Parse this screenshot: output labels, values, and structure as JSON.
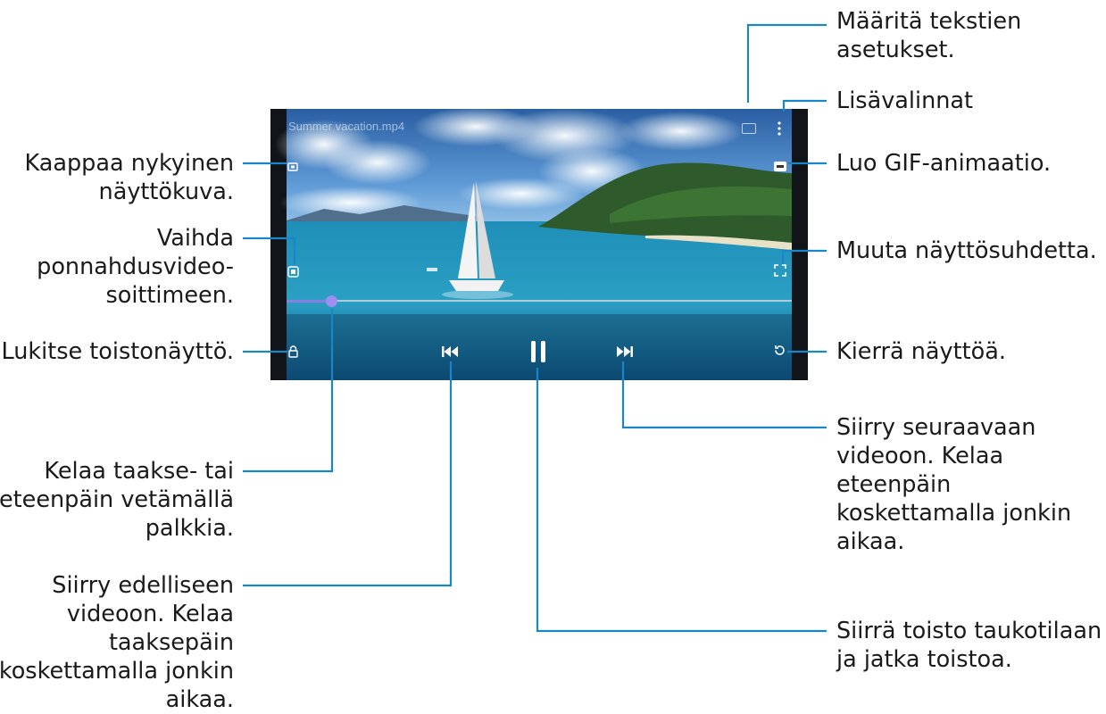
{
  "player": {
    "video_title": "Summer vacation.mp4",
    "progress_fraction": 0.09
  },
  "callouts": {
    "subtitles": "Määritä tekstien\nasetukset.",
    "more_options": "Lisävalinnat",
    "gif": "Luo GIF-animaatio.",
    "screen_ratio": "Muuta näyttösuhdetta.",
    "rotate": "Kierrä näyttöä.",
    "next": "Siirry seuraavaan\nvideoon. Kelaa\neteenpäin\nkoskettamalla jonkin\naikaa.",
    "pause": "Siirrä toisto taukotilaan\nja jatka toistoa.",
    "capture": "Kaappaa nykyinen\nnäyttökuva.",
    "popup": "Vaihda\nponnahdusvideo-\nsoittimeen.",
    "lock": "Lukitse toistonäyttö.",
    "scrub": "Kelaa taakse- tai\neteenpäin vetämällä\npalkkia.",
    "previous": "Siirry edelliseen\nvideoon. Kelaa\ntaaksepäin\nkoskettamalla jonkin\naikaa."
  },
  "colors": {
    "leader": "#1a86c7",
    "text": "#1a1a1a"
  },
  "icons": {
    "capture": "capture-icon",
    "popup": "popup-icon",
    "lock": "lock-icon",
    "subtitles": "subtitles-icon",
    "more": "more-options-icon",
    "gif": "gif-icon",
    "ratio": "screen-ratio-icon",
    "rotate": "rotate-icon",
    "previous": "previous-icon",
    "pause": "pause-icon",
    "next": "next-icon"
  }
}
